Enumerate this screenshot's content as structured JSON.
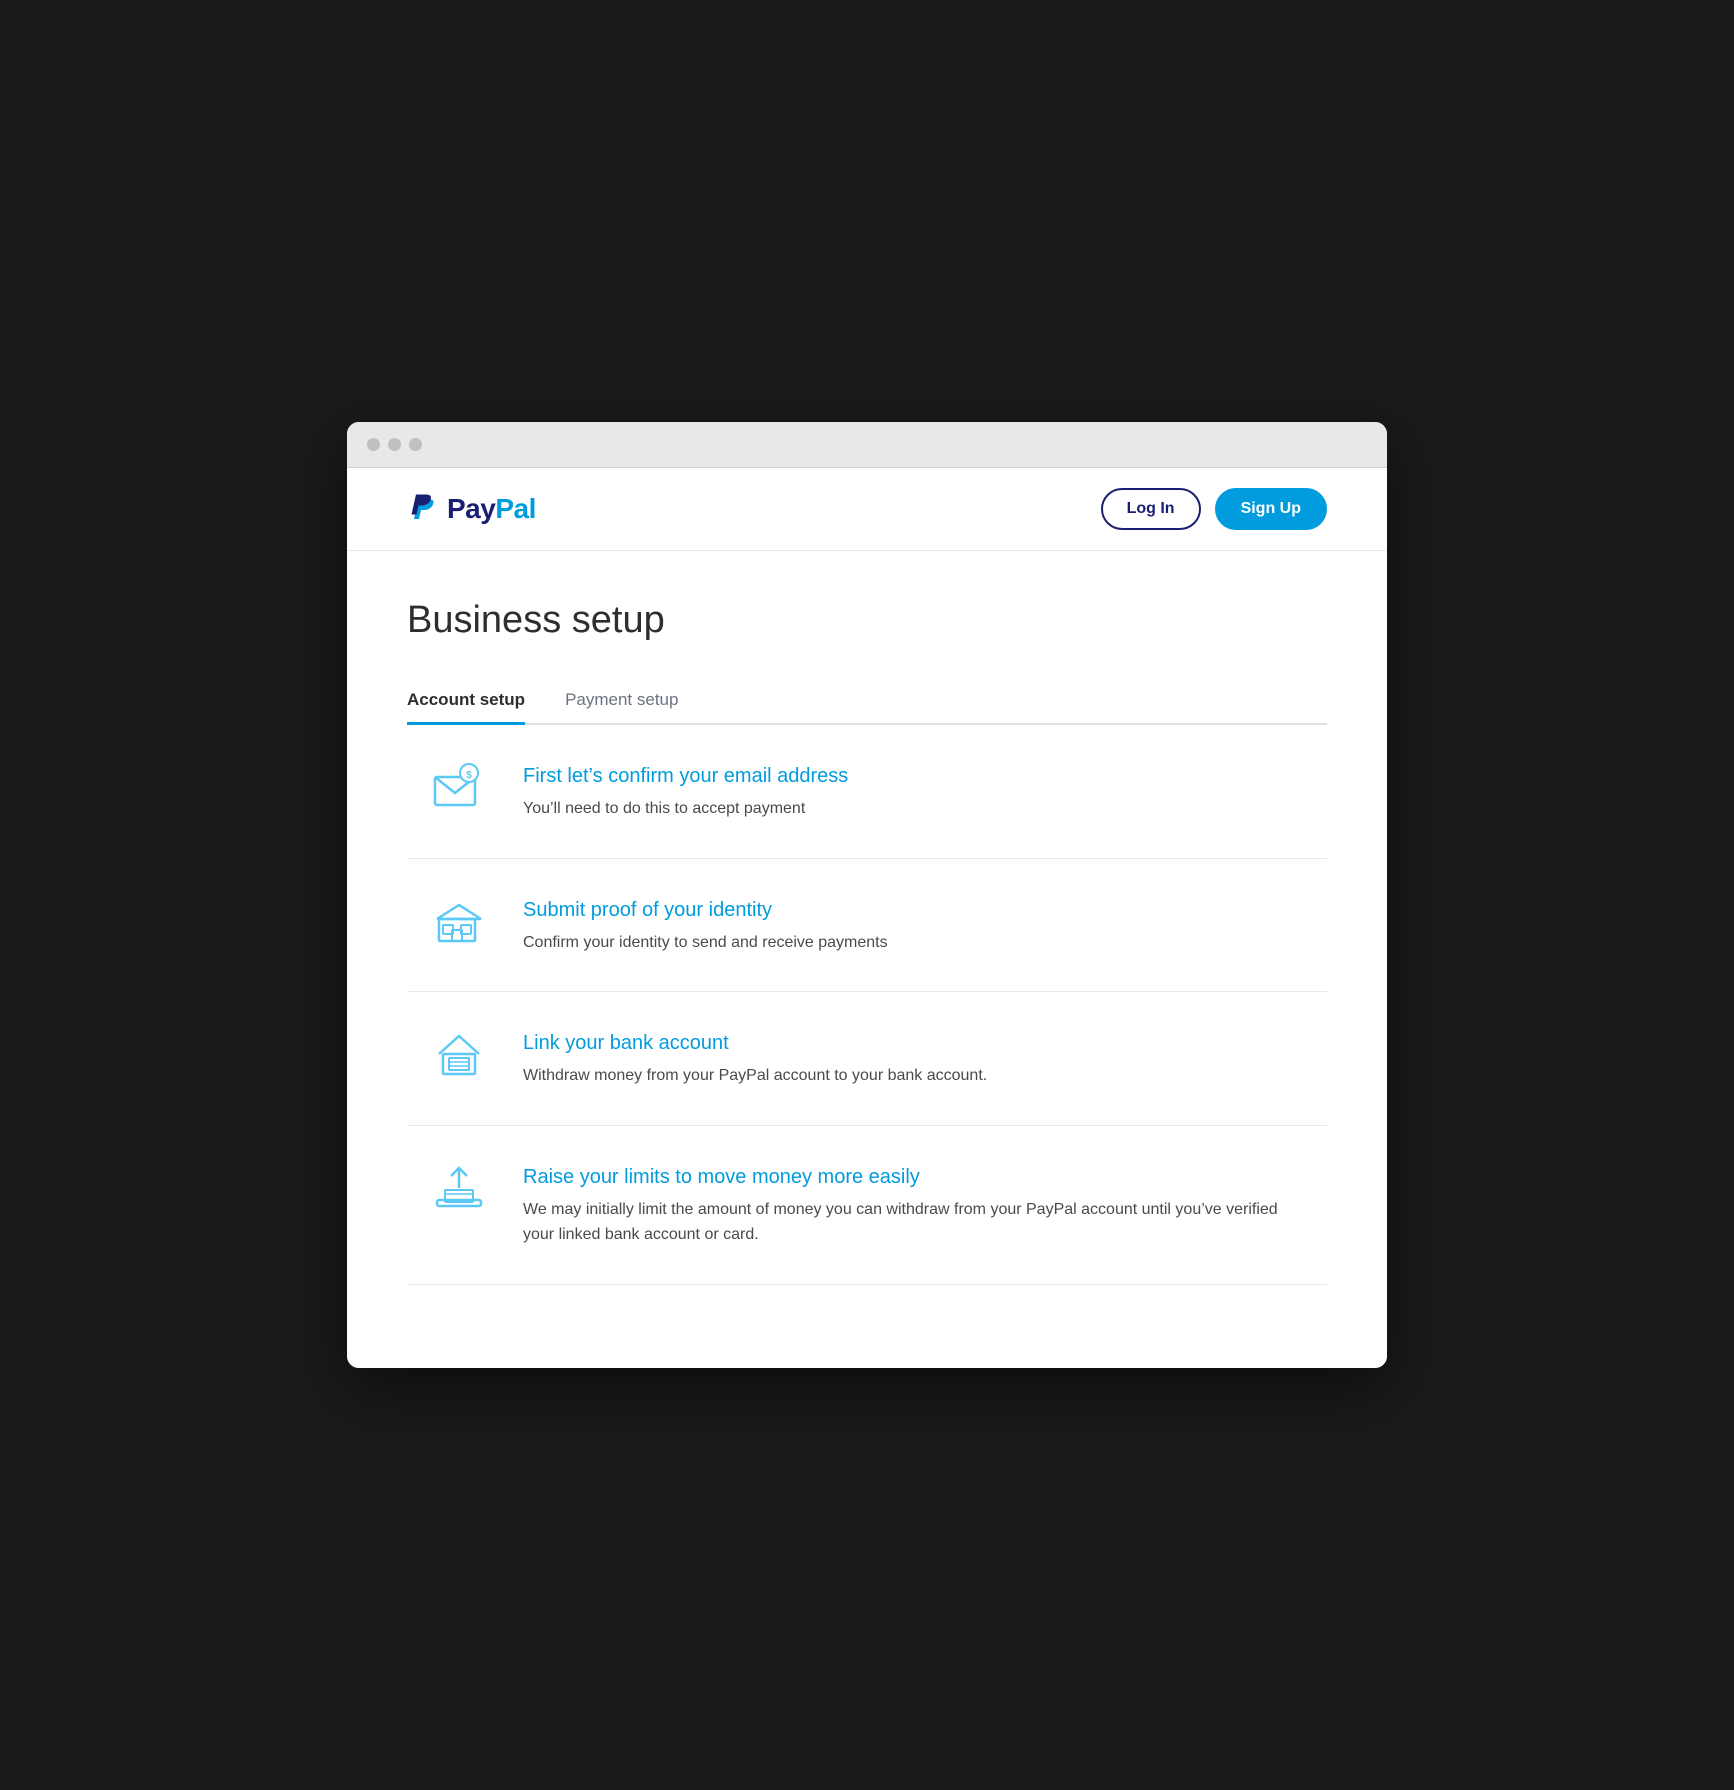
{
  "browser": {
    "dots": [
      "dot1",
      "dot2",
      "dot3"
    ]
  },
  "header": {
    "logo": {
      "pay": "Pay",
      "pal": "Pal"
    },
    "login_label": "Log In",
    "signup_label": "Sign Up"
  },
  "main": {
    "page_title": "Business setup",
    "tabs": [
      {
        "label": "Account setup",
        "active": true
      },
      {
        "label": "Payment setup",
        "active": false
      }
    ],
    "setup_items": [
      {
        "icon": "email",
        "title": "First let’s confirm your email address",
        "description": "You’ll need to do this to accept payment"
      },
      {
        "icon": "store",
        "title": "Submit proof of your identity",
        "description": "Confirm your identity to send and receive payments"
      },
      {
        "icon": "bank",
        "title": "Link your bank account",
        "description": "Withdraw money from your PayPal account to your bank account."
      },
      {
        "icon": "limits",
        "title": "Raise your limits to move money more easily",
        "description": "We may initially limit the amount of money you can withdraw from your PayPal account until you’ve verified your linked bank account or card."
      }
    ]
  }
}
